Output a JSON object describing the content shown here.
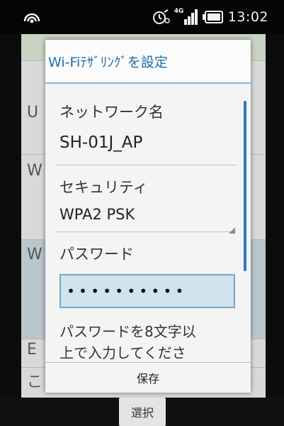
{
  "status_bar": {
    "time": "13:02",
    "network": "4G",
    "icons": [
      "hotspot-icon",
      "alarm-icon",
      "signal-icon",
      "battery-icon"
    ]
  },
  "background": {
    "rows": [
      {
        "text": "U"
      },
      {
        "text": "W"
      },
      {
        "text": "W"
      },
      {
        "text": "E"
      },
      {
        "text": "こ"
      }
    ]
  },
  "dialog": {
    "title": "Wi-Fiﾃｻﾞﾘﾝｸﾞを設定",
    "network_name_label": "ネットワーク名",
    "network_name_value": "SH-01J_AP",
    "security_label": "セキュリティ",
    "security_value": "WPA2 PSK",
    "password_label": "パスワード",
    "password_value": "••••••••••",
    "note_line1": "パスワードを8文字以",
    "note_line2": "上で入力してくださ",
    "save_label": "保存"
  },
  "softkey": {
    "center_label": "選択"
  },
  "colors": {
    "title_text": "#1e6fa8",
    "title_divider": "#8bb6d6",
    "input_focus_bg": "#cfe4ee",
    "scroll_indicator": "#2f78c0"
  }
}
